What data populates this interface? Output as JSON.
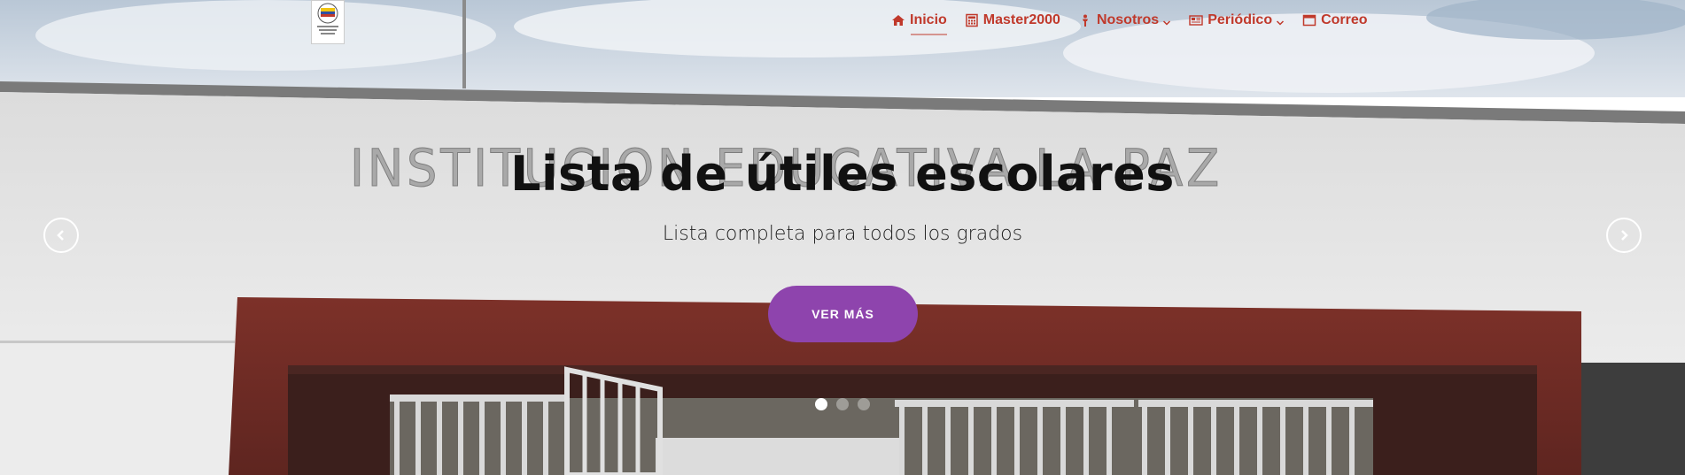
{
  "nav": {
    "items": [
      {
        "label": "Inicio",
        "icon": "home-icon",
        "active": true
      },
      {
        "label": "Master2000",
        "icon": "calculator-icon"
      },
      {
        "label": "Nosotros",
        "icon": "person-icon",
        "dropdown": true
      },
      {
        "label": "Periódico",
        "icon": "newspaper-icon",
        "dropdown": true
      },
      {
        "label": "Correo",
        "icon": "window-icon"
      }
    ]
  },
  "hero": {
    "wall_sign": "INSTITUCION EDUCATIVA LA PAZ",
    "title": "Lista de útiles escolares",
    "subtitle": "Lista completa para todos los grados",
    "cta_label": "VER MÁS",
    "slide_count": 3,
    "active_slide": 1
  },
  "colors": {
    "nav_text": "#c0392b",
    "cta_bg": "#8e44ad",
    "wall_red": "#7b2f2a"
  }
}
